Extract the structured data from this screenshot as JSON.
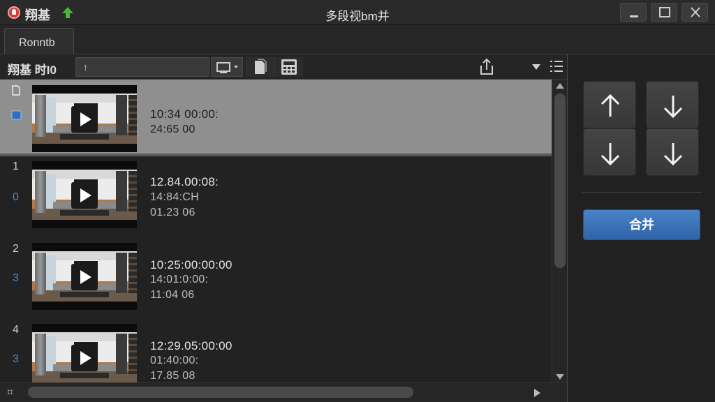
{
  "app": {
    "name": "翔基",
    "window_title": "多段视bm并"
  },
  "tabs": [
    {
      "label": "Ronntb"
    }
  ],
  "toolbar": {
    "label": "翔基 时I0",
    "input_value": "↑"
  },
  "rows": [
    {
      "num_top": "",
      "num_bottom": "",
      "t1": "10:34 00:00:",
      "t2": "24:65 00",
      "t3": ""
    },
    {
      "num_top": "1",
      "num_bottom": "0",
      "t1": "12.84.00:08:",
      "t2": "14:84:CH",
      "t3": "01.23 06"
    },
    {
      "num_top": "2",
      "num_bottom": "3",
      "t1": "10:25:00:00:00",
      "t2": "14:01:0:00:",
      "t3": "11:04 06"
    },
    {
      "num_top": "4",
      "num_bottom": "3",
      "t1": "12:29.05:00:00",
      "t2": "01:40:00:",
      "t3": "17.85 08"
    }
  ],
  "sidebar": {
    "merge_label": "合并"
  },
  "hscroll": {
    "grip": "⌗"
  }
}
